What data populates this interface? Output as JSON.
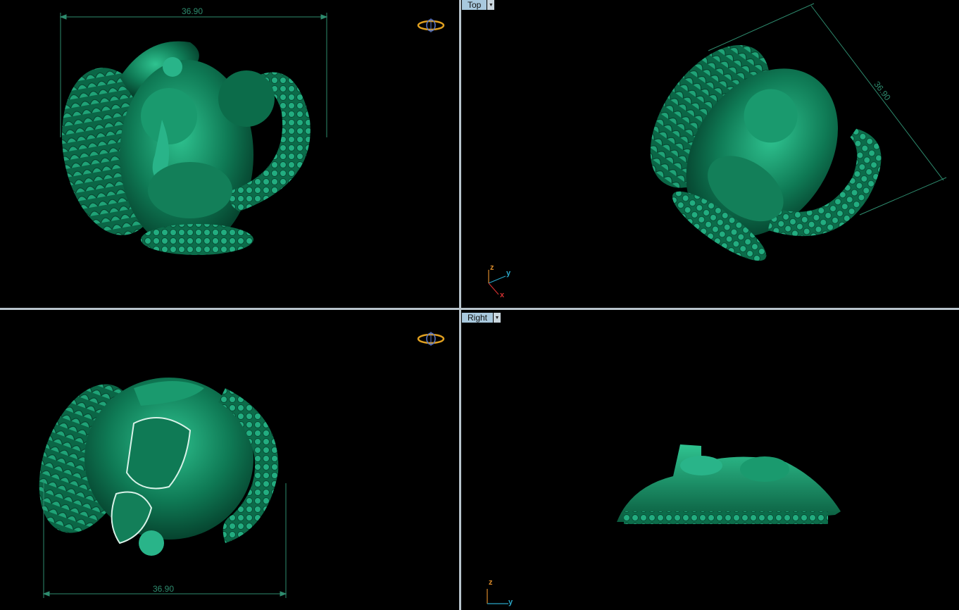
{
  "viewports": {
    "top_left": {
      "dimension": "36.90"
    },
    "top_right": {
      "label": "Top",
      "dimension": "36.90",
      "axes": {
        "z": "z",
        "y": "y",
        "x": "x"
      }
    },
    "bottom_left": {
      "dimension": "36.90"
    },
    "bottom_right": {
      "label": "Right",
      "axes": {
        "z": "z",
        "y": "y"
      }
    }
  },
  "colors": {
    "model": "#0f7a55",
    "model_highlight": "#29b489",
    "dimension": "#2e8b6e",
    "tab_bg": "#a9c9de",
    "divider": "#b8c4cc",
    "axis_x": "#d03030",
    "axis_y": "#2aa6c7",
    "axis_z": "#d98a2a"
  },
  "icons": {
    "gizmo": "rotation-gizmo-icon",
    "dropdown": "chevron-down-icon"
  }
}
